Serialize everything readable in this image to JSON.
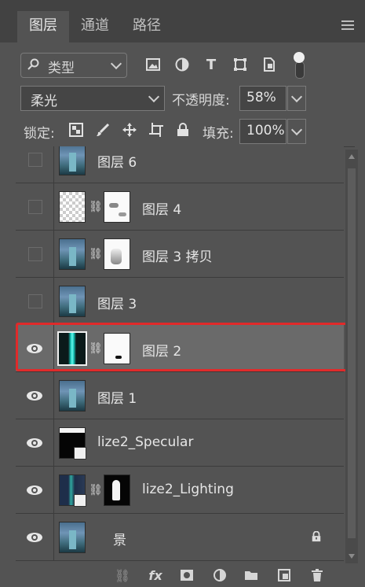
{
  "tabs": [
    {
      "label": "图层",
      "active": true
    },
    {
      "label": "通道",
      "active": false
    },
    {
      "label": "路径",
      "active": false
    }
  ],
  "filter": {
    "search_icon": "search-icon",
    "kind_label": "类型"
  },
  "filter_icons": [
    "image-filter-icon",
    "adjustment-filter-icon",
    "type-filter-icon",
    "shape-filter-icon",
    "smart-object-filter-icon"
  ],
  "blend": {
    "mode": "柔光",
    "opacity_label": "不透明度:",
    "opacity_value": "58%"
  },
  "lock": {
    "label": "锁定:",
    "fill_label": "填充:",
    "fill_value": "100%"
  },
  "layers": [
    {
      "name": "图层 6",
      "visible": false,
      "thumb": "city",
      "mask": null
    },
    {
      "name": "图层 4",
      "visible": false,
      "thumb": "checker",
      "mask": "white-spots"
    },
    {
      "name": "图层 3 拷贝",
      "visible": false,
      "thumb": "city",
      "mask": "white-gray"
    },
    {
      "name": "图层 3",
      "visible": false,
      "thumb": "city",
      "mask": null
    },
    {
      "name": "图层 2",
      "visible": true,
      "thumb": "teal",
      "mask": "white",
      "selected": true
    },
    {
      "name": "图层 1",
      "visible": true,
      "thumb": "city",
      "mask": null
    },
    {
      "name": "lize2_Specular",
      "visible": true,
      "thumb": "black",
      "mask": null,
      "smart": true
    },
    {
      "name": "lize2_Lighting",
      "visible": true,
      "thumb": "city-teal",
      "mask": "black-figure",
      "smart": true
    },
    {
      "name": "景",
      "visible": true,
      "thumb": "city",
      "mask": null,
      "locked": true
    }
  ],
  "bottom_icons": [
    "link-layers-icon",
    "fx-icon",
    "add-mask-icon",
    "adjustment-layer-icon",
    "new-group-icon",
    "new-layer-icon",
    "delete-icon"
  ],
  "bottom_fx_label": "fx",
  "colors": {
    "panel": "#535353",
    "tabbar": "#424242",
    "selected_row": "#6a6a6a",
    "highlight": "#e02a2a"
  }
}
